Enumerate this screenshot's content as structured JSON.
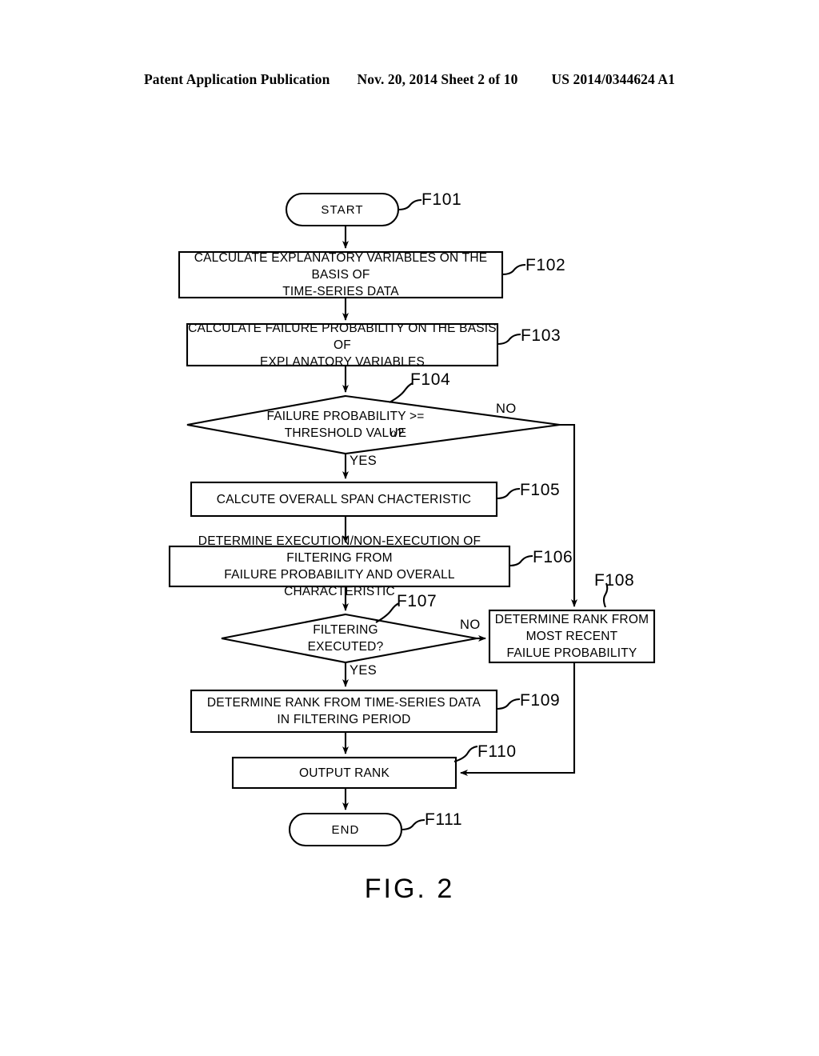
{
  "header": {
    "left": "Patent Application Publication",
    "middle": "Nov. 20, 2014  Sheet 2 of 10",
    "right": "US 2014/0344624 A1"
  },
  "figure": {
    "caption": "FIG. 2",
    "nodes": [
      {
        "id": "F101",
        "type": "terminal",
        "text": "START",
        "ref": "F101"
      },
      {
        "id": "F102",
        "type": "process",
        "text": "CALCULATE EXPLANATORY VARIABLES ON THE BASIS OF\nTIME-SERIES DATA",
        "ref": "F102"
      },
      {
        "id": "F103",
        "type": "process",
        "text": "CALCULATE FAILURE PROBABILITY ON THE BASIS OF\nEXPLANATORY VARIABLES",
        "ref": "F103"
      },
      {
        "id": "F104",
        "type": "decision",
        "text": "FAILURE PROBABILITY >=\nTHRESHOLD VALUE",
        "text_suffix": "?",
        "symbol": "α",
        "ref": "F104"
      },
      {
        "id": "F105",
        "type": "process",
        "text": "CALCUTE OVERALL SPAN CHACTERISTIC",
        "ref": "F105"
      },
      {
        "id": "F106",
        "type": "process",
        "text": "DETERMINE EXECUTION/NON-EXECUTION OF FILTERING FROM\nFAILURE PROBABILITY AND OVERALL CHARACTERISTIC",
        "ref": "F106"
      },
      {
        "id": "F107",
        "type": "decision",
        "text": "FILTERING\nEXECUTED?",
        "ref": "F107"
      },
      {
        "id": "F108",
        "type": "process",
        "text": "DETERMINE RANK FROM\nMOST RECENT\nFAILUE PROBABILITY",
        "ref": "F108"
      },
      {
        "id": "F109",
        "type": "process",
        "text": "DETERMINE RANK FROM TIME-SERIES DATA\nIN FILTERING PERIOD",
        "ref": "F109"
      },
      {
        "id": "F110",
        "type": "process",
        "text": "OUTPUT RANK",
        "ref": "F110"
      },
      {
        "id": "F111",
        "type": "terminal",
        "text": "END",
        "ref": "F111"
      }
    ],
    "branches": {
      "f104_no": "NO",
      "f104_yes": "YES",
      "f107_no": "NO",
      "f107_yes": "YES"
    },
    "line_color": "#000000"
  }
}
